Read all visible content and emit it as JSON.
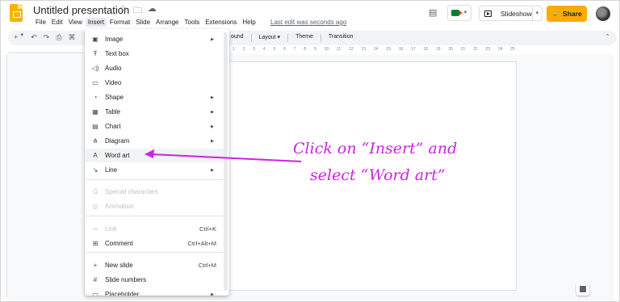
{
  "header": {
    "doc_title": "Untitled presentation",
    "title_icons": [
      "star-icon",
      "folder-icon",
      "cloud-icon"
    ],
    "menu": [
      "File",
      "Edit",
      "View",
      "Insert",
      "Format",
      "Slide",
      "Arrange",
      "Tools",
      "Extensions",
      "Help"
    ],
    "active_menu": "Insert",
    "last_edit": "Last edit was seconds ago",
    "slideshow_label": "Slideshow",
    "share_label": "Share"
  },
  "toolbar": {
    "background_label": "ound",
    "layout_label": "Layout",
    "theme_label": "Theme",
    "transition_label": "Transition"
  },
  "ruler": {
    "ticks": [
      "1",
      "2",
      "3",
      "4",
      "5",
      "6",
      "7",
      "8",
      "9",
      "10",
      "11",
      "12",
      "13",
      "14",
      "15",
      "16",
      "17",
      "18",
      "19",
      "20",
      "21",
      "22",
      "23",
      "24",
      "25"
    ]
  },
  "insert_menu": {
    "items": [
      {
        "label": "Image",
        "icon": "image-icon",
        "glyph": "▣",
        "submenu": true
      },
      {
        "label": "Text box",
        "icon": "text-box-icon",
        "glyph": "Ŧ",
        "submenu": false
      },
      {
        "label": "Audio",
        "icon": "audio-icon",
        "glyph": "◁)",
        "submenu": false
      },
      {
        "label": "Video",
        "icon": "video-icon",
        "glyph": "▭",
        "submenu": false
      },
      {
        "label": "Shape",
        "icon": "shape-icon",
        "glyph": "◔",
        "submenu": true
      },
      {
        "label": "Table",
        "icon": "table-icon",
        "glyph": "▦",
        "submenu": true
      },
      {
        "label": "Chart",
        "icon": "chart-icon",
        "glyph": "▤",
        "submenu": true
      },
      {
        "label": "Diagram",
        "icon": "diagram-icon",
        "glyph": "⋔",
        "submenu": true
      },
      {
        "label": "Word art",
        "icon": "word-art-icon",
        "glyph": "A",
        "submenu": false,
        "highlighted": true
      },
      {
        "label": "Line",
        "icon": "line-icon",
        "glyph": "↘",
        "submenu": true
      },
      {
        "label": "Special characters",
        "icon": "special-characters-icon",
        "glyph": "Ω",
        "submenu": false,
        "disabled": true
      },
      {
        "label": "Animation",
        "icon": "animation-icon",
        "glyph": "◎",
        "submenu": false,
        "disabled": true
      },
      {
        "label": "Link",
        "icon": "link-icon",
        "glyph": "∞",
        "shortcut": "Ctrl+K",
        "disabled": true
      },
      {
        "label": "Comment",
        "icon": "comment-icon",
        "glyph": "⊞",
        "shortcut": "Ctrl+Alt+M"
      },
      {
        "label": "New slide",
        "icon": "new-slide-icon",
        "glyph": "+",
        "shortcut": "Ctrl+M"
      },
      {
        "label": "Slide numbers",
        "icon": "slide-numbers-icon",
        "glyph": "#"
      },
      {
        "label": "Placeholder",
        "icon": "placeholder-icon",
        "glyph": "▭",
        "submenu": true
      }
    ]
  },
  "annotation": {
    "line1": "Click on “Insert” and",
    "line2": "select “Word art”",
    "color": "#cc22e6"
  }
}
